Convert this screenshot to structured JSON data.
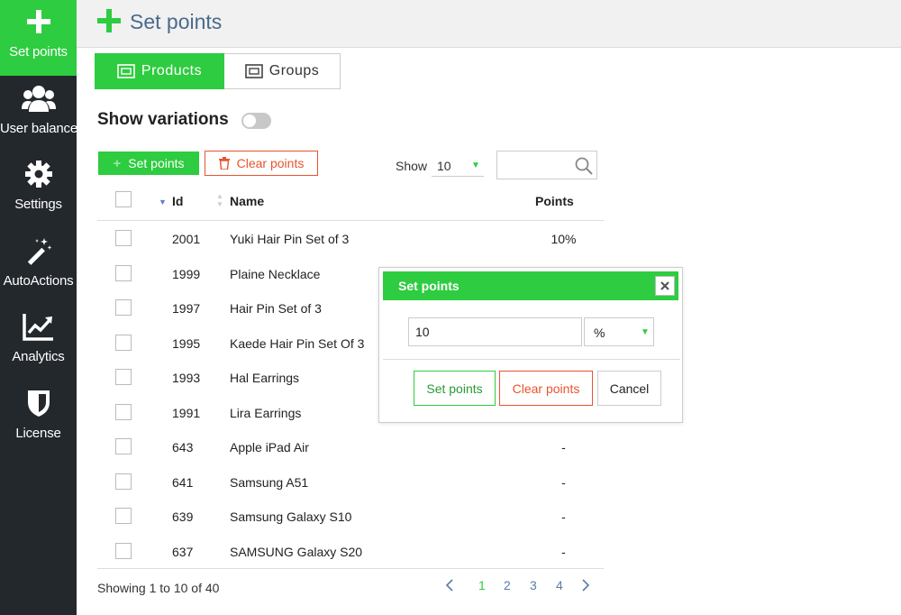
{
  "sidebar": {
    "items": [
      {
        "label": "Set points",
        "icon": "plus-icon"
      },
      {
        "label": "User balance",
        "icon": "users-icon"
      },
      {
        "label": "Settings",
        "icon": "gear-icon"
      },
      {
        "label": "AutoActions",
        "icon": "magic-wand-icon"
      },
      {
        "label": "Analytics",
        "icon": "chart-line-icon"
      },
      {
        "label": "License",
        "icon": "shield-icon"
      }
    ]
  },
  "header": {
    "title": "Set points"
  },
  "tabs": [
    {
      "label": "Products"
    },
    {
      "label": "Groups"
    }
  ],
  "variations": {
    "label": "Show variations",
    "enabled": false
  },
  "toolbar": {
    "set_points_label": "Set points",
    "clear_points_label": "Clear points",
    "show_label": "Show",
    "show_value": "10",
    "search_placeholder": ""
  },
  "table": {
    "columns": {
      "id": "Id",
      "name": "Name",
      "points": "Points"
    },
    "rows": [
      {
        "id": "2001",
        "name": "Yuki Hair Pin Set of 3",
        "points": "10%"
      },
      {
        "id": "1999",
        "name": "Plaine Necklace",
        "points": ""
      },
      {
        "id": "1997",
        "name": "Hair Pin Set of 3",
        "points": ""
      },
      {
        "id": "1995",
        "name": "Kaede Hair Pin Set Of 3",
        "points": ""
      },
      {
        "id": "1993",
        "name": "Hal Earrings",
        "points": ""
      },
      {
        "id": "1991",
        "name": "Lira Earrings",
        "points": ""
      },
      {
        "id": "643",
        "name": "Apple iPad Air",
        "points": "-"
      },
      {
        "id": "641",
        "name": "Samsung A51",
        "points": "-"
      },
      {
        "id": "639",
        "name": "Samsung Galaxy S10",
        "points": "-"
      },
      {
        "id": "637",
        "name": "SAMSUNG Galaxy S20",
        "points": "-"
      }
    ]
  },
  "footer": {
    "showing": "Showing 1 to 10 of 40",
    "pages": [
      "1",
      "2",
      "3",
      "4"
    ],
    "current_page": "1",
    "prev_icon": "chevron-left-icon",
    "next_icon": "chevron-right-icon"
  },
  "modal": {
    "title": "Set points",
    "input_value": "10",
    "unit_value": "%",
    "set_label": "Set points",
    "clear_label": "Clear points",
    "cancel_label": "Cancel"
  },
  "colors": {
    "accent": "#2ecc40",
    "danger": "#e8542c",
    "sidebar": "#23282d",
    "link": "#5b7ca6"
  }
}
